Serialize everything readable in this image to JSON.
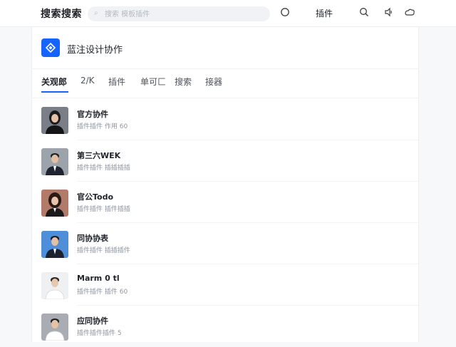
{
  "header": {
    "brand": "搜索搜索",
    "search_placeholder": "搜索 模板插件",
    "plugin_label": "插件",
    "icons": [
      "circle-icon",
      "search-icon",
      "notification-icon",
      "cloud-icon"
    ]
  },
  "team": {
    "name": "蓝注设计协作",
    "logo_icon": "diamond-icon"
  },
  "tabs": [
    {
      "label": "关观郎"
    },
    {
      "label": "2/K"
    },
    {
      "label": "插件"
    },
    {
      "label": "单可匚"
    },
    {
      "label": "搜索"
    },
    {
      "label": "接器"
    }
  ],
  "items": [
    {
      "title": "官方协件",
      "subtitle": "插件插件 作用 60"
    },
    {
      "title": "第三六WEK",
      "subtitle": "插件插件 插插插插"
    },
    {
      "title": "官公Todo",
      "subtitle": "插件插件 插件插插"
    },
    {
      "title": "同协协表",
      "subtitle": "插件插件 插插插件"
    },
    {
      "title": "Marm 0 tl",
      "subtitle": "插件插件 插件 60"
    },
    {
      "title": "应同协件",
      "subtitle": "插件插件插件 5"
    }
  ],
  "colors": {
    "accent": "#1664ff"
  }
}
